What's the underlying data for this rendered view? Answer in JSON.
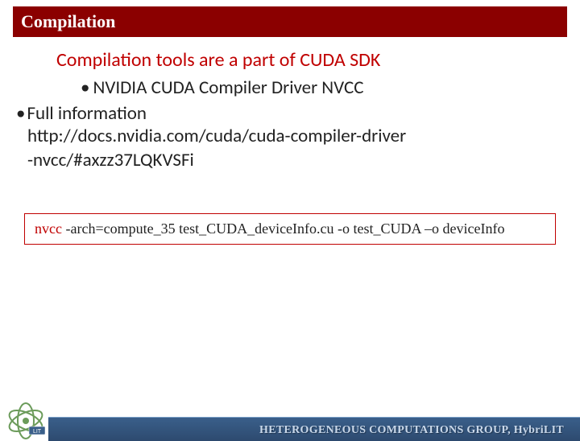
{
  "title": "Compilation",
  "subtitle": "Compilation tools are a part of CUDA SDK",
  "bullet_driver": "NVIDIA CUDA Compiler Driver NVCC",
  "bullet_full": "Full information",
  "url_line1": "http://docs.nvidia.com/cuda/cuda-compiler-driver",
  "url_line2": "-nvcc/#axzz37LQKVSFi",
  "command": {
    "prog": "nvcc",
    "args": " -arch=compute_35 test_CUDA_deviceInfo.cu -o test_CUDA –o deviceInfo"
  },
  "footer": "HETEROGENEOUS COMPUTATIONS GROUP,   HybriLIT"
}
